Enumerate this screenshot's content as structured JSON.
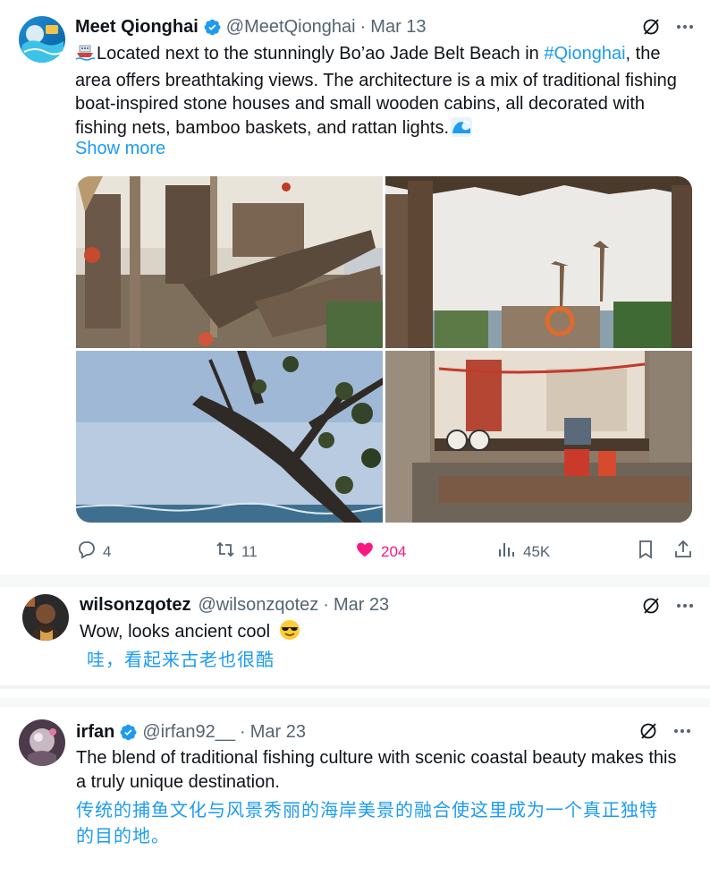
{
  "main_tweet": {
    "name": "Meet Qionghai",
    "handle": "@MeetQionghai",
    "separator": "·",
    "date": "Mar 13",
    "text_before": "Located next to the stunningly Bo’ao Jade Belt Beach in ",
    "hashtag": "#Qionghai",
    "text_after": ", the area offers breathtaking views. The architecture is a mix of traditional fishing boat-inspired stone houses and small wooden cabins, all decorated with fishing nets, bamboo baskets, and rattan lights.",
    "show_more": "Show more",
    "stats": {
      "replies": "4",
      "reposts": "11",
      "likes": "204",
      "views": "45K"
    },
    "icons": [
      "ship-emoji-icon",
      "wave-emoji-icon",
      "grok-icon",
      "more-icon",
      "reply-icon",
      "repost-icon",
      "like-icon",
      "views-icon",
      "bookmark-icon",
      "share-icon"
    ],
    "media": [
      "fishing-village-boat-photo",
      "beach-terrace-photo",
      "tree-branch-sea-photo",
      "cafe-interior-photo"
    ]
  },
  "replies": [
    {
      "name": "wilsonzqotez",
      "handle": "@wilsonzqotez",
      "separator": "·",
      "date": "Mar 23",
      "text": "Wow, looks ancient cool",
      "emoji": "sunglasses-emoji-icon",
      "translation": "哇，看起来古老也很酷"
    },
    {
      "name": "irfan",
      "handle": "@irfan92__",
      "separator": "·",
      "date": "Mar 23",
      "text": "The blend of traditional fishing culture with scenic coastal beauty makes this a truly unique destination.",
      "translation": "传统的捕鱼文化与风景秀丽的海岸美景的融合使这里成为一个真正独特的目的地。"
    }
  ],
  "colors": {
    "link": "#1d9bf0",
    "muted": "#536471",
    "like": "#f91880",
    "text": "#0f1419"
  }
}
